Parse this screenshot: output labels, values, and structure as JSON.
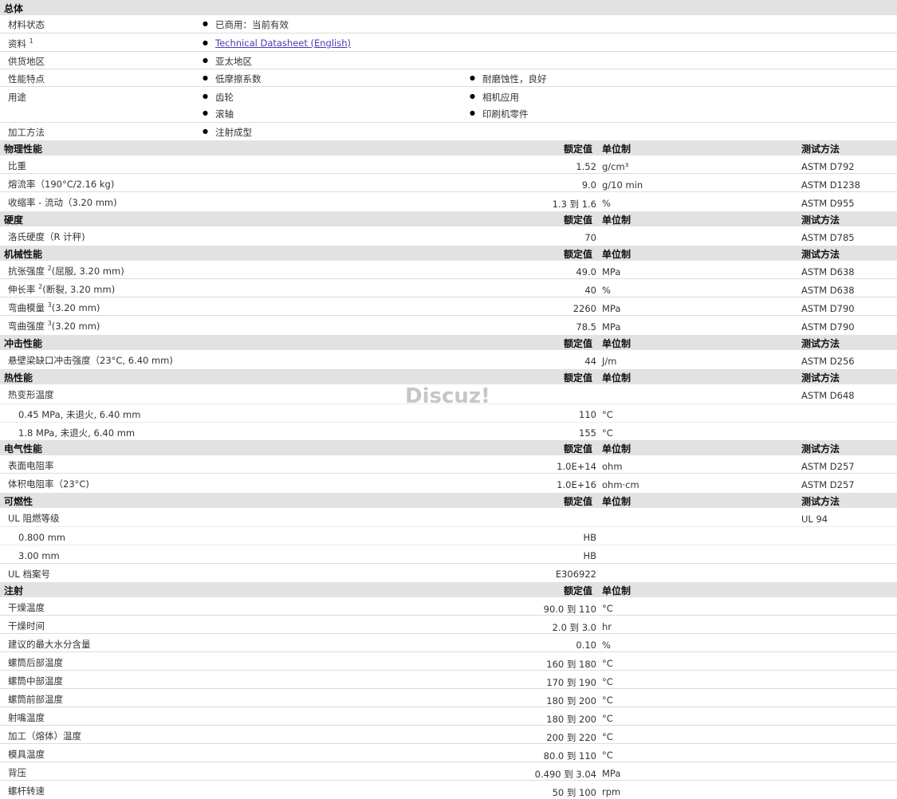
{
  "general": {
    "title": "总体",
    "rows": [
      {
        "label": "材料状态",
        "sup": "",
        "items": [
          "已商用：当前有效"
        ]
      },
      {
        "label": "资料",
        "sup": "1",
        "items": [
          "Technical Datasheet (English)"
        ]
      },
      {
        "label": "供货地区",
        "sup": "",
        "items": [
          "亚太地区"
        ]
      },
      {
        "label": "性能特点",
        "sup": "",
        "items": [
          "低摩擦系数",
          "耐磨蚀性，良好"
        ]
      },
      {
        "label": "用途",
        "sup": "",
        "items": [
          "齿轮",
          "相机应用",
          "滚轴",
          "印刷机零件"
        ]
      },
      {
        "label": "加工方法",
        "sup": "",
        "items": [
          "注射成型"
        ]
      }
    ]
  },
  "col_headers": {
    "value": "额定值",
    "unit": "单位制",
    "method": "测试方法"
  },
  "physical": {
    "title": "物理性能",
    "rows": [
      {
        "label": "比重",
        "value": "1.52",
        "unit": "g/cm³",
        "method": "ASTM D792"
      },
      {
        "label": "熔流率（190°C/2.16 kg)",
        "value": "9.0",
        "unit": "g/10 min",
        "method": "ASTM D1238"
      },
      {
        "label": "收缩率 - 流动（3.20 mm)",
        "value": "1.3 到  1.6",
        "unit": "%",
        "method": "ASTM D955"
      }
    ]
  },
  "hardness": {
    "title": "硬度",
    "rows": [
      {
        "label": "洛氏硬度（R 计秤)",
        "value": "70",
        "unit": "",
        "method": "ASTM D785"
      }
    ]
  },
  "mechanical": {
    "title": "机械性能",
    "rows": [
      {
        "label": "抗张强度",
        "sup": "2",
        "suffix": "(屈服, 3.20 mm)",
        "value": "49.0",
        "unit": "MPa",
        "method": "ASTM D638"
      },
      {
        "label": "伸长率",
        "sup": "2",
        "suffix": "(断裂, 3.20 mm)",
        "value": "40",
        "unit": "%",
        "method": "ASTM D638"
      },
      {
        "label": "弯曲模量",
        "sup": "3",
        "suffix": "(3.20 mm)",
        "value": "2260",
        "unit": "MPa",
        "method": "ASTM D790"
      },
      {
        "label": "弯曲强度",
        "sup": "3",
        "suffix": "(3.20 mm)",
        "value": "78.5",
        "unit": "MPa",
        "method": "ASTM D790"
      }
    ]
  },
  "impact": {
    "title": "冲击性能",
    "rows": [
      {
        "label": "悬壁梁缺口冲击强度（23°C, 6.40 mm)",
        "value": "44",
        "unit": "J/m",
        "method": "ASTM D256"
      }
    ]
  },
  "thermal": {
    "title": "热性能",
    "rows": [
      {
        "label": "热变形温度",
        "value": "",
        "unit": "",
        "method": "ASTM D648"
      },
      {
        "label": "0.45 MPa, 未退火, 6.40 mm",
        "value": "110",
        "unit": "°C",
        "method": ""
      },
      {
        "label": "1.8 MPa, 未退火, 6.40 mm",
        "value": "155",
        "unit": "°C",
        "method": ""
      }
    ]
  },
  "electrical": {
    "title": "电气性能",
    "rows": [
      {
        "label": "表面电阻率",
        "value": "1.0E+14",
        "unit": "ohm",
        "method": "ASTM D257"
      },
      {
        "label": "体积电阻率（23°C)",
        "value": "1.0E+16",
        "unit": "ohm·cm",
        "method": "ASTM D257"
      }
    ]
  },
  "flammability": {
    "title": "可燃性",
    "rows": [
      {
        "label": "UL 阻燃等级",
        "value": "",
        "unit": "",
        "method": "UL 94"
      },
      {
        "label": "0.800 mm",
        "value": "HB",
        "unit": "",
        "method": ""
      },
      {
        "label": "3.00 mm",
        "value": "HB",
        "unit": "",
        "method": ""
      },
      {
        "label": "UL 档案号",
        "value": "E306922",
        "unit": "",
        "method": ""
      }
    ]
  },
  "injection": {
    "title": "注射",
    "rows": [
      {
        "label": "干燥温度",
        "value": "90.0 到  110",
        "unit": "°C"
      },
      {
        "label": "干燥时间",
        "value": "2.0 到  3.0",
        "unit": "hr"
      },
      {
        "label": "建议的最大水分含量",
        "value": "0.10",
        "unit": "%"
      },
      {
        "label": "螺筒后部温度",
        "value": "160 到  180",
        "unit": "°C"
      },
      {
        "label": "螺筒中部温度",
        "value": "170 到  190",
        "unit": "°C"
      },
      {
        "label": "螺筒前部温度",
        "value": "180 到  200",
        "unit": "°C"
      },
      {
        "label": "射嘴温度",
        "value": "180 到  200",
        "unit": "°C"
      },
      {
        "label": "加工（熔体）温度",
        "value": "200 到  220",
        "unit": "°C"
      },
      {
        "label": "模具温度",
        "value": "80.0 到  110",
        "unit": "°C"
      },
      {
        "label": "背压",
        "value": "0.490 到  3.04",
        "unit": "MPa"
      },
      {
        "label": "螺杆转速",
        "value": "50 到  100",
        "unit": "rpm"
      }
    ]
  },
  "watermark": "Discuz!"
}
